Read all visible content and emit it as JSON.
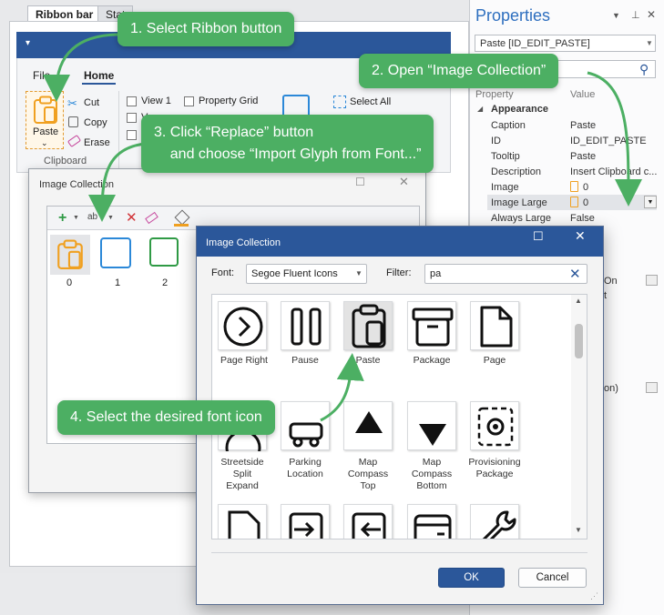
{
  "designer": {
    "doc_tabs": [
      "Ribbon bar",
      "Stat"
    ],
    "ribbon_tabs": [
      "File",
      "Home"
    ],
    "paste_label": "Paste",
    "clipboard_items": [
      "Cut",
      "Copy",
      "Erase"
    ],
    "clipboard_group": "Clipboard",
    "view_checks": [
      "View 1",
      "V",
      "C"
    ],
    "property_grid": "Property Grid",
    "select_all": "Select All"
  },
  "properties": {
    "title": "Properties",
    "object_selector": "Paste [ID_EDIT_PASTE]",
    "col_property": "Property",
    "col_value": "Value",
    "category": "Appearance",
    "rows": [
      {
        "name": "Caption",
        "value": "Paste"
      },
      {
        "name": "ID",
        "value": "ID_EDIT_PASTE"
      },
      {
        "name": "Tooltip",
        "value": "Paste"
      },
      {
        "name": "Description",
        "value": "Insert Clipboard c..."
      },
      {
        "name": "Image",
        "value": "0"
      },
      {
        "name": "Image Large",
        "value": "0"
      },
      {
        "name": "Always Large",
        "value": "False"
      }
    ],
    "partial_values": [
      "On",
      "t",
      "on)"
    ]
  },
  "small_dialog": {
    "title": "Image Collection",
    "items": [
      "0",
      "1",
      "2"
    ]
  },
  "big_dialog": {
    "title": "Image Collection",
    "font_label": "Font:",
    "font_value": "Segoe Fluent Icons",
    "filter_label": "Filter:",
    "filter_value": "pa",
    "row1": [
      "Page Right",
      "Pause",
      "Paste",
      "Package",
      "Page"
    ],
    "row2": [
      "Streetside\nSplit\nExpand",
      "Parking\nLocation",
      "Map\nCompass\nTop",
      "Map\nCompass\nBottom",
      "Provisioning\nPackage"
    ],
    "ok_label": "OK",
    "cancel_label": "Cancel"
  },
  "callouts": {
    "step1": "1. Select Ribbon button",
    "step2": "2. Open “Image Collection”",
    "step3": "3. Click “Replace” button\n    and choose “Import Glyph from Font...”",
    "step4": "4. Select the desired font icon"
  },
  "colors": {
    "accent": "#2b579a",
    "callout": "#4caf63",
    "paste_icon": "#f0a020"
  }
}
